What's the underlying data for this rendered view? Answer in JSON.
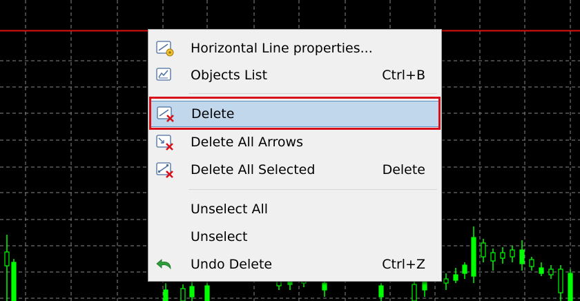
{
  "menu": {
    "items": [
      {
        "label": "Horizontal Line properties...",
        "shortcut": "",
        "icon": "line-properties-icon"
      },
      {
        "label": "Objects List",
        "shortcut": "Ctrl+B",
        "icon": "objects-list-icon"
      },
      {
        "label": "Delete",
        "shortcut": "",
        "icon": "delete-icon",
        "highlighted": true
      },
      {
        "label": "Delete All Arrows",
        "shortcut": "",
        "icon": "delete-arrows-icon"
      },
      {
        "label": "Delete All Selected",
        "shortcut": "Delete",
        "icon": "delete-selected-icon"
      },
      {
        "label": "Unselect All",
        "shortcut": ""
      },
      {
        "label": "Unselect",
        "shortcut": ""
      },
      {
        "label": "Undo Delete",
        "shortcut": "Ctrl+Z",
        "icon": "undo-icon"
      }
    ]
  },
  "colors": {
    "chart_background": "#000000",
    "grid": "#8a8a8a",
    "candles": "#00ff00",
    "horizontal_line": "#e01010",
    "highlight_fill": "#c1d7ec",
    "annotation_box": "#d8101a"
  }
}
